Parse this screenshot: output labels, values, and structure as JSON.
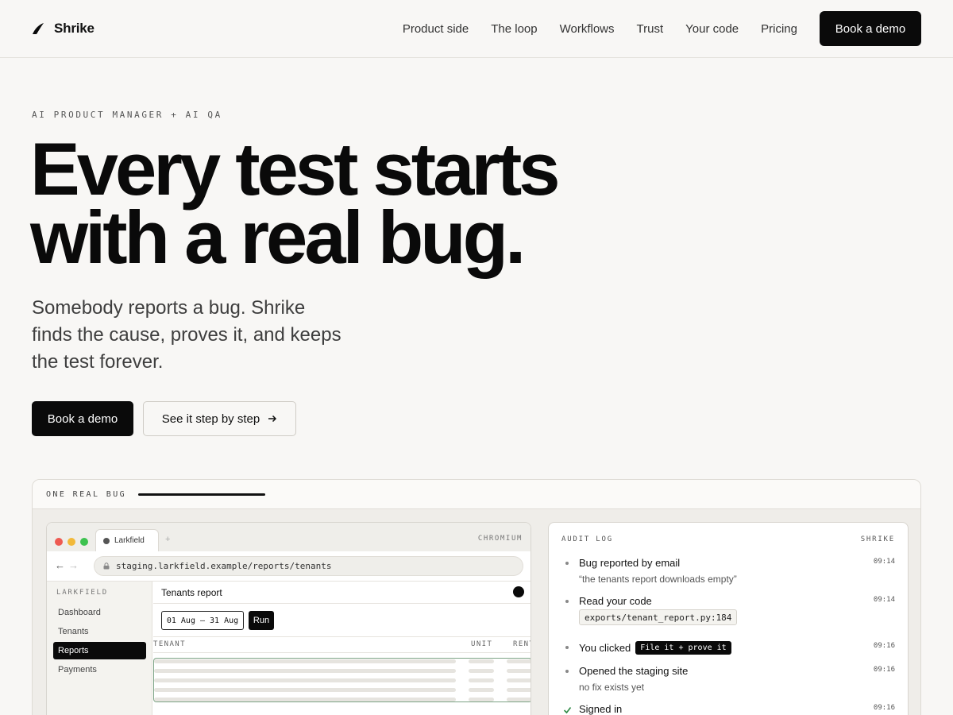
{
  "nav": {
    "brand": "Shrike",
    "links": [
      "Product side",
      "The loop",
      "Workflows",
      "Trust",
      "Your code",
      "Pricing"
    ],
    "cta": "Book a demo"
  },
  "hero": {
    "eyebrow": "AI PRODUCT MANAGER + AI QA",
    "headline_line1": "Every test starts",
    "headline_line2": "with a real bug.",
    "subhead": "Somebody reports a bug. Shrike finds the cause, proves it, and keeps the test forever.",
    "primary_cta": "Book a demo",
    "secondary_cta": "See it step by step",
    "secondary_cta_icon": "arrow-right-icon"
  },
  "demo": {
    "label": "ONE REAL BUG",
    "progress": 1.0,
    "browser": {
      "tab_title": "Larkfield",
      "new_tab": "+",
      "engine": "CHROMIUM",
      "back": "←",
      "forward": "→",
      "url": "staging.larkfield.example/reports/tenants",
      "app": {
        "brand": "LARKFIELD",
        "sidebar_items": [
          "Dashboard",
          "Tenants",
          "Reports",
          "Payments"
        ],
        "active_item": "Reports",
        "title": "Tenants report",
        "date_range": "01 Aug – 31 Aug",
        "run": "Run",
        "columns": [
          "TENANT",
          "UNIT",
          "RENT"
        ]
      }
    },
    "audit": {
      "label": "AUDIT LOG",
      "brand": "SHRIKE",
      "entries": [
        {
          "title": "Bug reported by email",
          "time": "09:14",
          "sub": "“the tenants report downloads empty”"
        },
        {
          "title": "Read your code",
          "time": "09:14",
          "code": "exports/tenant_report.py:184"
        },
        {
          "title": "You clicked",
          "pill": "File it + prove it",
          "time": "09:16"
        },
        {
          "title": "Opened the staging site",
          "time": "09:16",
          "sub": "no fix exists yet"
        },
        {
          "title": "Signed in",
          "time": "09:16",
          "icon": "check-icon"
        }
      ]
    }
  },
  "colors": {
    "background": "#f8f7f5",
    "ink": "#0a0a0a",
    "highlight_border": "#7ca384"
  }
}
